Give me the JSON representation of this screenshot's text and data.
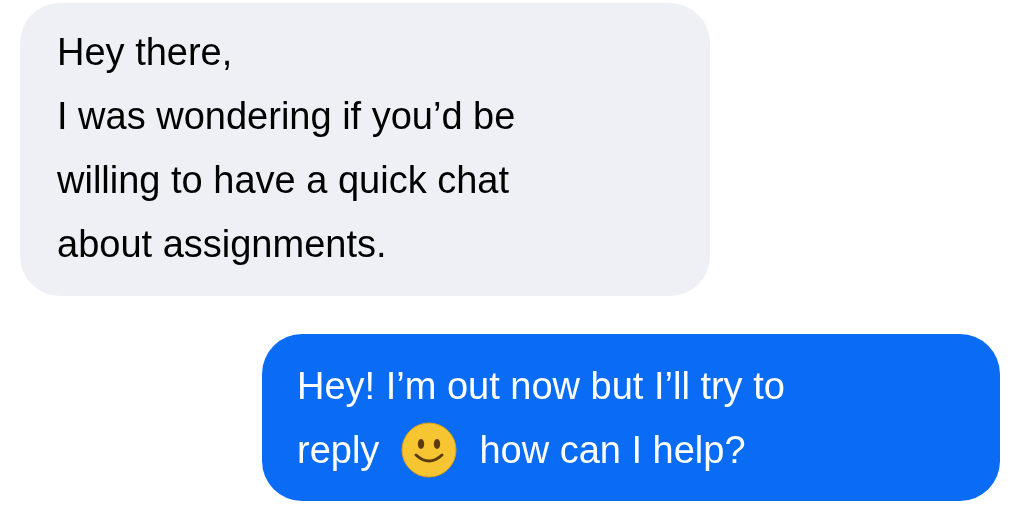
{
  "messages": [
    {
      "kind": "received",
      "lines": [
        [
          {
            "kind": "text",
            "text": "Hey there,"
          }
        ],
        [
          {
            "kind": "text",
            "text": "I was wondering if you’d be"
          }
        ],
        [
          {
            "kind": "text",
            "text": "willing to have a quick chat"
          }
        ],
        [
          {
            "kind": "text",
            "text": "about assignments."
          }
        ]
      ]
    },
    {
      "kind": "sent",
      "lines": [
        [
          {
            "kind": "text",
            "text": "Hey! I’m out now but I’ll try to"
          }
        ],
        [
          {
            "kind": "text",
            "text": "reply"
          },
          {
            "kind": "emoji"
          },
          {
            "kind": "text",
            "text": "how can I help?"
          }
        ]
      ]
    }
  ]
}
